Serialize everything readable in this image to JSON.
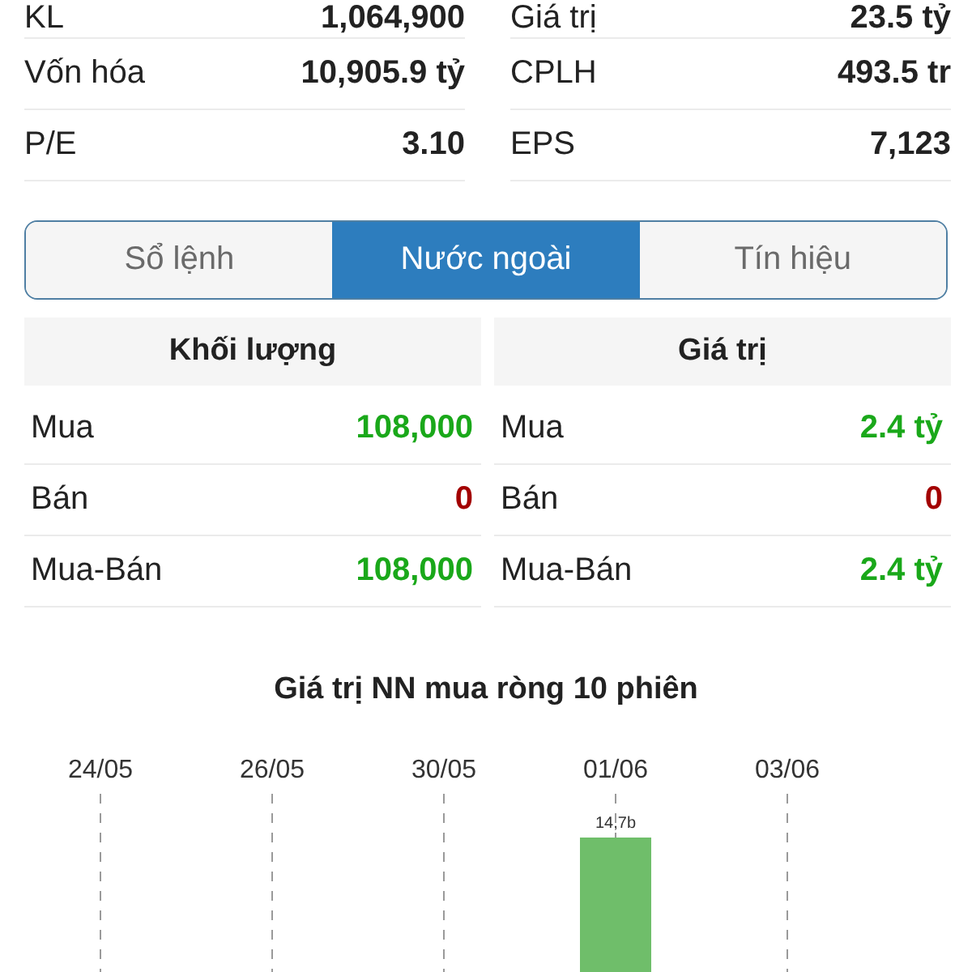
{
  "stats": {
    "left": [
      {
        "label": "KL",
        "value": "1,064,900"
      },
      {
        "label": "Vốn hóa",
        "value": "10,905.9 tỷ"
      },
      {
        "label": "P/E",
        "value": "3.10"
      }
    ],
    "right": [
      {
        "label": "Giá trị",
        "value": "23.5 tỷ"
      },
      {
        "label": "CPLH",
        "value": "493.5 tr"
      },
      {
        "label": "EPS",
        "value": "7,123"
      }
    ]
  },
  "tabs": [
    {
      "label": "Sổ lệnh",
      "selected": false
    },
    {
      "label": "Nước ngoài",
      "selected": true
    },
    {
      "label": "Tín hiệu",
      "selected": false
    }
  ],
  "foreign_trading": {
    "panels": [
      {
        "title": "Khối lượng",
        "rows": [
          {
            "label": "Mua",
            "value": "108,000",
            "color": "#1aa81a"
          },
          {
            "label": "Bán",
            "value": "0",
            "color": "#a30000"
          },
          {
            "label": "Mua-Bán",
            "value": "108,000",
            "color": "#1aa81a"
          }
        ]
      },
      {
        "title": "Giá trị",
        "rows": [
          {
            "label": "Mua",
            "value": "2.4 tỷ",
            "color": "#1aa81a"
          },
          {
            "label": "Bán",
            "value": "0",
            "color": "#a30000"
          },
          {
            "label": "Mua-Bán",
            "value": "2.4 tỷ",
            "color": "#1aa81a"
          }
        ]
      }
    ]
  },
  "net_buy_chart": {
    "chart_data": {
      "type": "bar",
      "title": "Giá trị NN mua ròng 10 phiên",
      "categories": [
        "24/05",
        "26/05",
        "30/05",
        "01/06",
        "03/06"
      ],
      "values": [
        null,
        null,
        null,
        14.7,
        null
      ],
      "value_labels": [
        null,
        null,
        null,
        "14,7b",
        null
      ],
      "grid": true
    }
  }
}
